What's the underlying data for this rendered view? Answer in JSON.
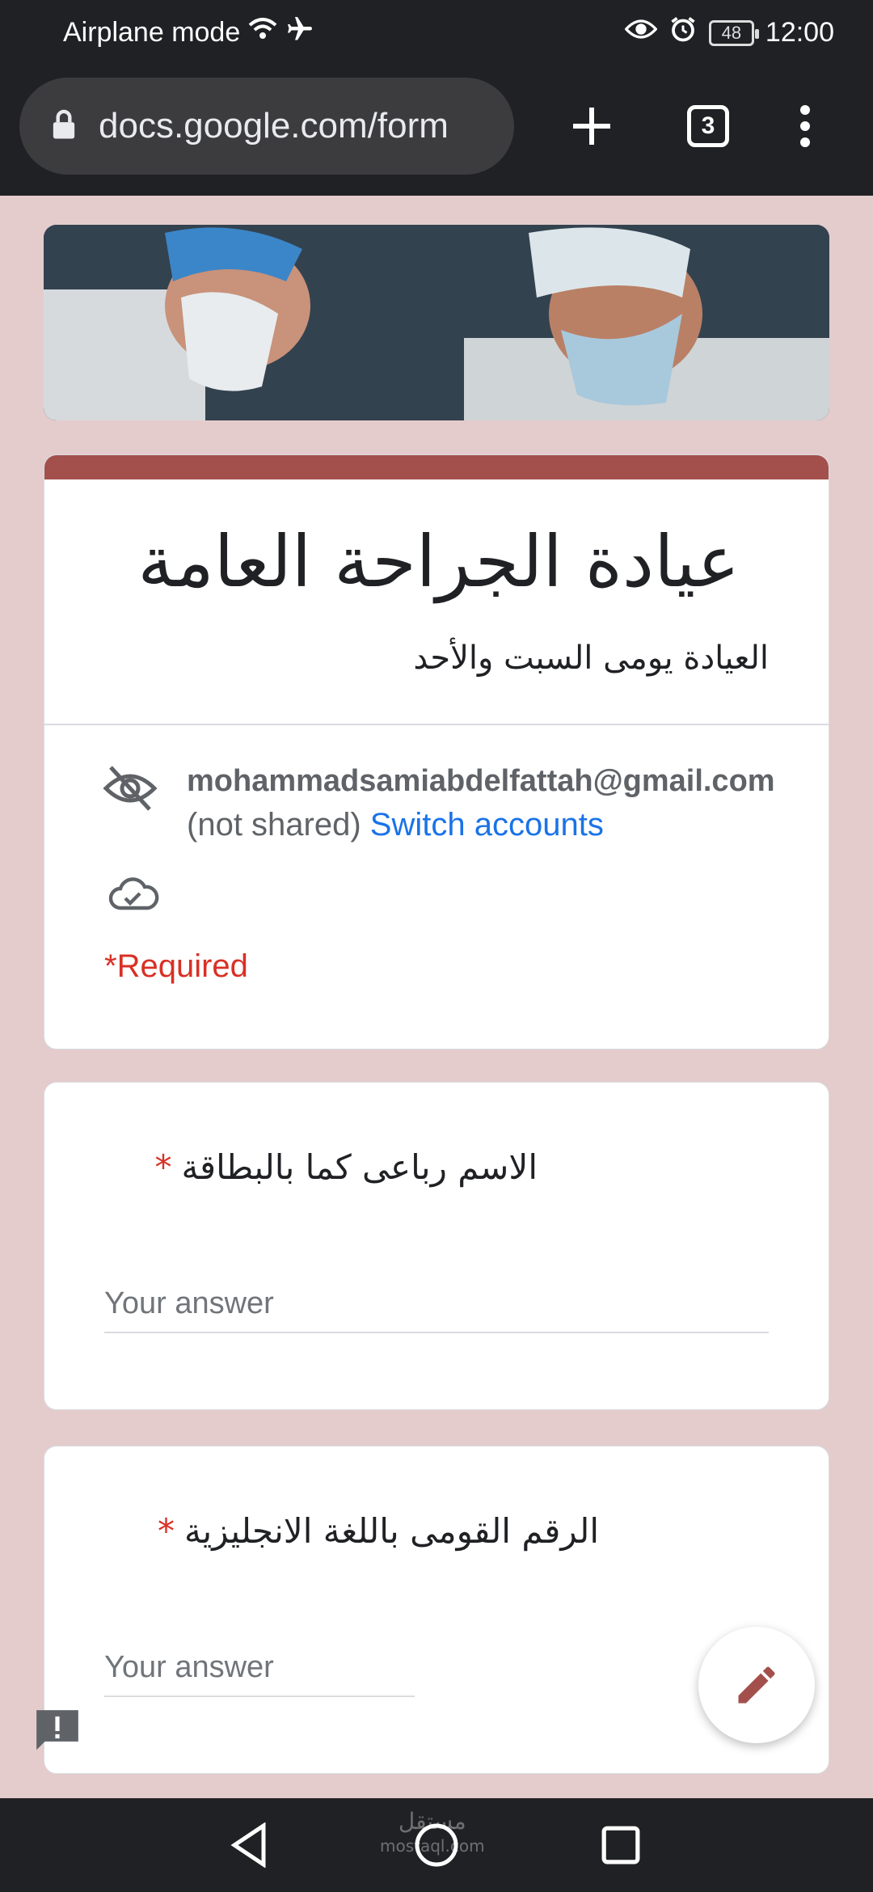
{
  "status_bar": {
    "left_text": "Airplane mode",
    "battery": "48",
    "time": "12:00",
    "icons": [
      "wifi-icon",
      "airplane-icon",
      "eye-icon",
      "alarm-icon",
      "battery-icon"
    ]
  },
  "browser": {
    "url": "docs.google.com/form",
    "tab_count": "3",
    "icons": [
      "lock-icon",
      "new-tab-icon",
      "tab-switcher-icon",
      "menu-icon"
    ]
  },
  "form": {
    "title": "عيادة الجراحة العامة",
    "description": "العيادة يومى السبت والأحد",
    "account": {
      "email": "mohammadsamiabdelfattah@gmail.com",
      "not_shared": "(not shared)",
      "switch_label": "Switch accounts"
    },
    "required_note": "*Required",
    "questions": [
      {
        "title": "الاسم رباعى كما بالبطاقة",
        "required_mark": "*",
        "placeholder": "Your answer"
      },
      {
        "title": "الرقم القومى باللغة الانجليزية",
        "required_mark": "*",
        "placeholder": "Your answer"
      }
    ]
  },
  "watermark": {
    "line1": "مستقل",
    "line2": "mostaql.com"
  },
  "colors": {
    "page_background": "#e4cccc",
    "accent": "#a3504d",
    "required": "#d93025",
    "link": "#1a73e8"
  }
}
